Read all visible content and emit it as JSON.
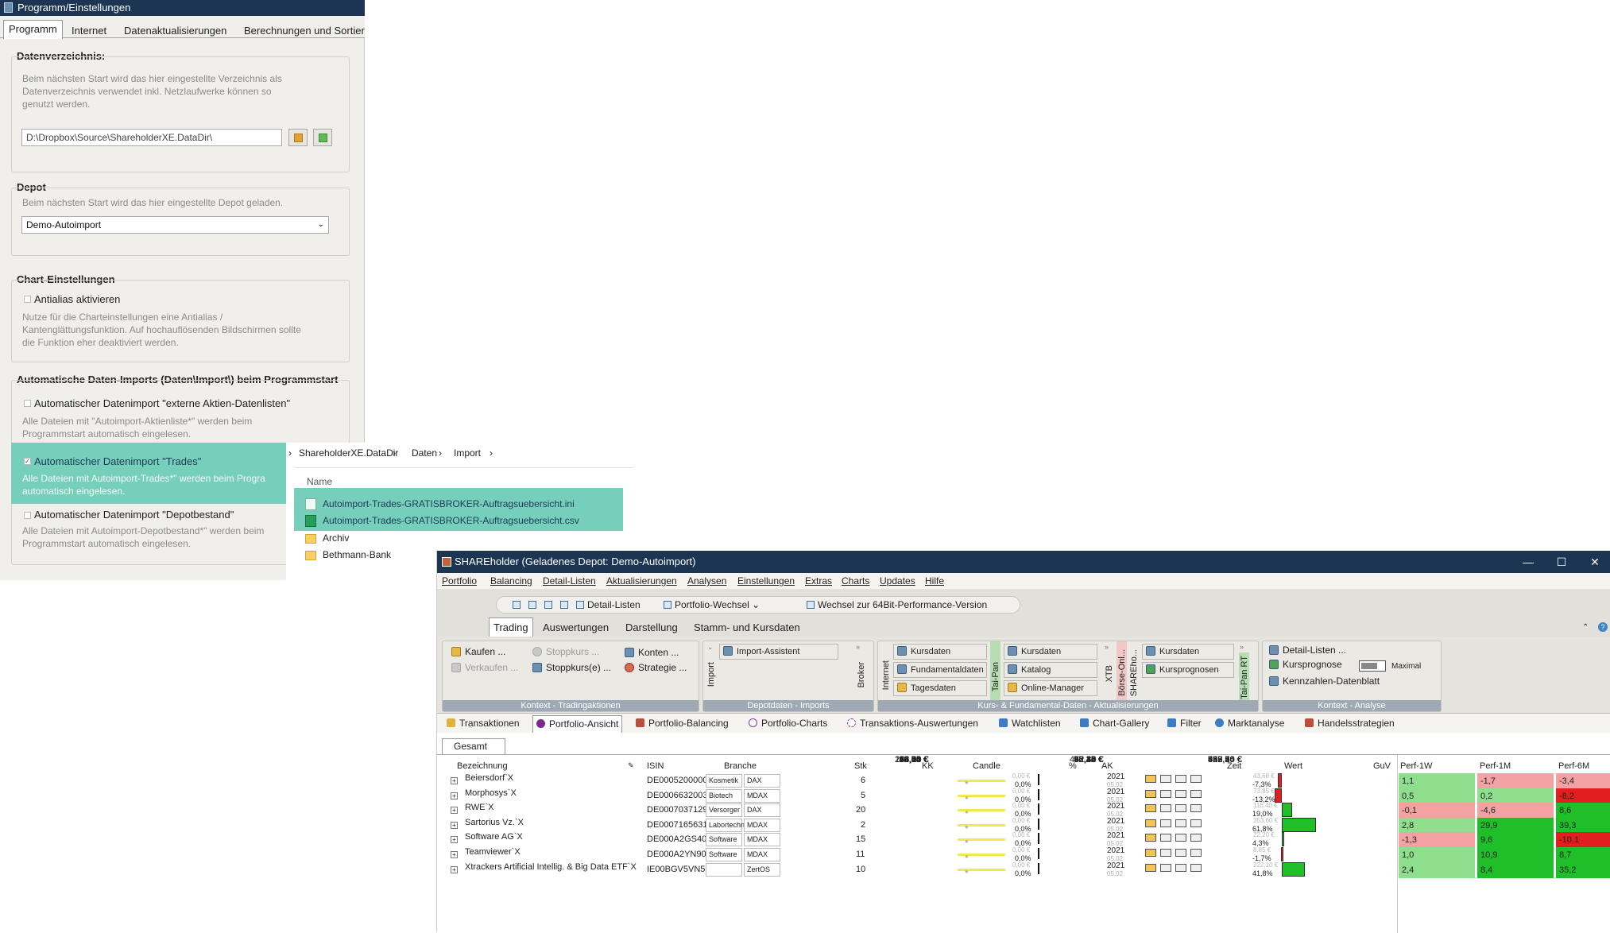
{
  "settings": {
    "title": "Programm/Einstellungen",
    "tabs": [
      "Programm",
      "Internet",
      "Datenaktualisierungen",
      "Berechnungen und Sortier"
    ],
    "groups": {
      "datadir": {
        "title": "Datenverzeichnis:",
        "desc": [
          "Beim nächsten Start wird das hier eingestellte Verzeichnis als",
          "Datenverzeichnis verwendet inkl. Netzlaufwerke können so",
          "genutzt werden."
        ],
        "path": "D:\\Dropbox\\Source\\ShareholderXE.DataDir\\"
      },
      "depot": {
        "title": "Depot",
        "desc": "Beim nächsten Start wird das hier eingestellte Depot geladen.",
        "value": "Demo-Autoimport"
      },
      "chart": {
        "title": "Chart-Einstellungen",
        "check": "Antialias aktivieren",
        "desc": [
          "Nutze für die Charteinstellungen eine Antialias /",
          "Kantenglättungsfunktion. Auf hochauflösenden Bildschirmen sollte",
          "die Funktion eher deaktiviert werden."
        ]
      },
      "autoimport": {
        "title": "Automatische Daten-Imports (Daten\\Import\\) beim Programmstart",
        "items": [
          {
            "label": "Automatischer Datenimport \"externe Aktien-Datenlisten\"",
            "desc": [
              "Alle Dateien mit \"Autoimport-Aktienliste*\" werden beim",
              "Programmstart automatisch eingelesen."
            ],
            "checked": false
          },
          {
            "label": "Automatischer Datenimport \"Trades\"",
            "desc": [
              "Alle Dateien mit Autoimport-Trades*\" werden beim Progra",
              "automatisch eingelesen."
            ],
            "checked": true
          },
          {
            "label": "Automatischer Datenimport \"Depotbestand\"",
            "desc": [
              "Alle Dateien mit Autoimport-Depotbestand*\" werden beim",
              "Programmstart automatisch eingelesen."
            ],
            "checked": false
          }
        ]
      }
    }
  },
  "explorer": {
    "breadcrumb": [
      "ShareholderXE.DataDir",
      "Daten",
      "Import"
    ],
    "column": "Name",
    "files": [
      {
        "name": "Autoimport-Trades-GRATISBROKER-Auftragsuebersicht.ini",
        "type": "ini"
      },
      {
        "name": "Autoimport-Trades-GRATISBROKER-Auftragsuebersicht.csv",
        "type": "csv"
      },
      {
        "name": "Archiv",
        "type": "folder"
      },
      {
        "name": "Bethmann-Bank",
        "type": "folder"
      }
    ]
  },
  "app": {
    "title": "SHAREholder (Geladenes Depot: Demo-Autoimport)",
    "window": {
      "min": "—",
      "max": "☐",
      "close": "✕"
    },
    "menu": [
      "Portfolio",
      "Balancing",
      "Detail-Listen",
      "Aktualisierungen",
      "Analysen",
      "Einstellungen",
      "Extras",
      "Charts",
      "Updates",
      "Hilfe"
    ],
    "quick": {
      "detail": "Detail-Listen",
      "portfolio": "Portfolio-Wechsel",
      "switch": "Wechsel zur 64Bit-Performance-Version"
    },
    "ribbon_tabs": [
      "Trading",
      "Auswertungen",
      "Darstellung",
      "Stamm- und Kursdaten"
    ],
    "ribbon": {
      "trading": {
        "kaufen": "Kaufen ...",
        "verkaufen": "Verkaufen ...",
        "stoppkurs": "Stoppkurs ...",
        "stoppkurse": "Stoppkurs(e) ...",
        "konten": "Konten ...",
        "strategie": "Strategie ...",
        "label": "Kontext - Tradingaktionen"
      },
      "imports": {
        "assistant": "Import-Assistent",
        "v_import": "Import",
        "v_broker": "Broker",
        "label": "Depotdaten - Imports"
      },
      "kurs": {
        "v_internet": "Internet",
        "kursdaten": "Kursdaten",
        "fundamental": "Fundamentaldaten",
        "tages": "Tagesdaten",
        "v_taipan": "Tai-Pan",
        "kursdaten2": "Kursdaten",
        "katalog": "Katalog",
        "online": "Online-Manager",
        "v_xtb": "XTB",
        "v_boerse": "Börse-Onl...",
        "v_share": "SHAREho...",
        "kursdaten3": "Kursdaten",
        "prognosen": "Kursprognosen",
        "v_taipanrt": "Tai-Pan RT",
        "label": "Kurs- & Fundamental-Daten - Aktualisierungen"
      },
      "analyse": {
        "detail": "Detail-Listen ...",
        "prognose": "Kursprognose",
        "maximal": "Maximal",
        "kennzahlen": "Kennzahlen-Datenblatt",
        "label": "Kontext - Analyse"
      }
    },
    "nav_tabs": [
      "Transaktionen",
      "Portfolio-Ansicht",
      "Portfolio-Balancing",
      "Portfolio-Charts",
      "Transaktions-Auswertungen",
      "Watchlisten",
      "Chart-Gallery",
      "Filter",
      "Marktanalyse",
      "Handelsstrategien"
    ],
    "subtab": "Gesamt",
    "columns": [
      "Bezeichnung",
      "ISIN",
      "Branche",
      "Stk",
      "KK",
      "Candle",
      "%",
      "AK",
      "Zeit",
      "Wert",
      "GuV",
      "Perf-1W",
      "Perf-1M",
      "Perf-6M"
    ],
    "rows": [
      {
        "name": "Beiersdorf`X",
        "isin": "DE0005200000",
        "branche": "Kosmetik",
        "index": "DAX",
        "stk": "6",
        "kk": "99,54 €",
        "pct_small": "0,00 €",
        "pct": "0,0%",
        "ak": "92,26 €",
        "year": "2021",
        "date": "05.02",
        "wert": "553,56 €",
        "guv_small": "43,68 €",
        "guv": "-7,3%",
        "p1w": "1,1",
        "p1m": "-1,7",
        "p6m": "-3,4"
      },
      {
        "name": "Morphosys`X",
        "isin": "DE0006632003",
        "branche": "Biotech",
        "index": "MDAX",
        "stk": "5",
        "kk": "112,15 €",
        "pct_small": "0,00 €",
        "pct": "0,0%",
        "ak": "97,38 €",
        "year": "2021",
        "date": "05.02",
        "wert": "486,90 €",
        "guv_small": "73,85 €",
        "guv": "-13,2%",
        "p1w": "0,5",
        "p1m": "0,2",
        "p6m": "-8,2"
      },
      {
        "name": "RWE`X",
        "isin": "DE0007037129",
        "branche": "Versorger",
        "index": "DAX",
        "stk": "20",
        "kk": "30,65 €",
        "pct_small": "0,00 €",
        "pct": "0,0%",
        "ak": "36,47 €",
        "year": "2021",
        "date": "05.02",
        "wert": "729,40 €",
        "guv_small": "116,40 €",
        "guv": "19,0%",
        "p1w": "-0,1",
        "p1m": "-4,6",
        "p6m": "8,6"
      },
      {
        "name": "Sartorius Vz.`X",
        "isin": "DE0007165631",
        "branche": "Labortechnik",
        "index": "MDAX",
        "stk": "2",
        "kk": "286,00 €",
        "pct_small": "0,00 €",
        "pct": "0,0%",
        "ak": "462,80 €",
        "year": "2021",
        "date": "05.02",
        "wert": "925,60 €",
        "guv_small": "353,60 €",
        "guv": "61,8%",
        "p1w": "2,8",
        "p1m": "29,9",
        "p6m": "39,3"
      },
      {
        "name": "Software AG`X",
        "isin": "DE000A2GS401",
        "branche": "Software",
        "index": "MDAX",
        "stk": "15",
        "kk": "34,70 €",
        "pct_small": "0,00 €",
        "pct": "0,0%",
        "ak": "36,18 €",
        "year": "2021",
        "date": "05.02",
        "wert": "542,70 €",
        "guv_small": "22,20 €",
        "guv": "4,3%",
        "p1w": "-1,3",
        "p1m": "9,6",
        "p6m": "-10,1"
      },
      {
        "name": "Teamviewer`X",
        "isin": "DE000A2YN900",
        "branche": "Software",
        "index": "MDAX",
        "stk": "11",
        "kk": "46,05 €",
        "pct_small": "0,00 €",
        "pct": "0,0%",
        "ak": "45,24 €",
        "year": "2021",
        "date": "05.02",
        "wert": "497,64 €",
        "guv_small": "8,85 €",
        "guv": "-1,7%",
        "p1w": "1,0",
        "p1m": "10,9",
        "p6m": "8,7"
      },
      {
        "name": "Xtrackers Artificial Intellig. & Big Data ETF`X",
        "isin": "IE00BGV5VN51",
        "branche": "",
        "index": "ZertOS",
        "stk": "10",
        "kk": "53,11 €",
        "pct_small": "0,00 €",
        "pct": "0,0%",
        "ak": "75,32 €",
        "year": "2021",
        "date": "05.02",
        "wert": "753,20 €",
        "guv_small": "222,10 €",
        "guv": "41,8%",
        "p1w": "2,4",
        "p1m": "8,4",
        "p6m": "35,2"
      }
    ],
    "colors": {
      "pos_strong": "#1fbf2a",
      "pos_light": "#8fde8d",
      "neg_light": "#f2a2a2",
      "neg_strong": "#e21e1e"
    }
  }
}
